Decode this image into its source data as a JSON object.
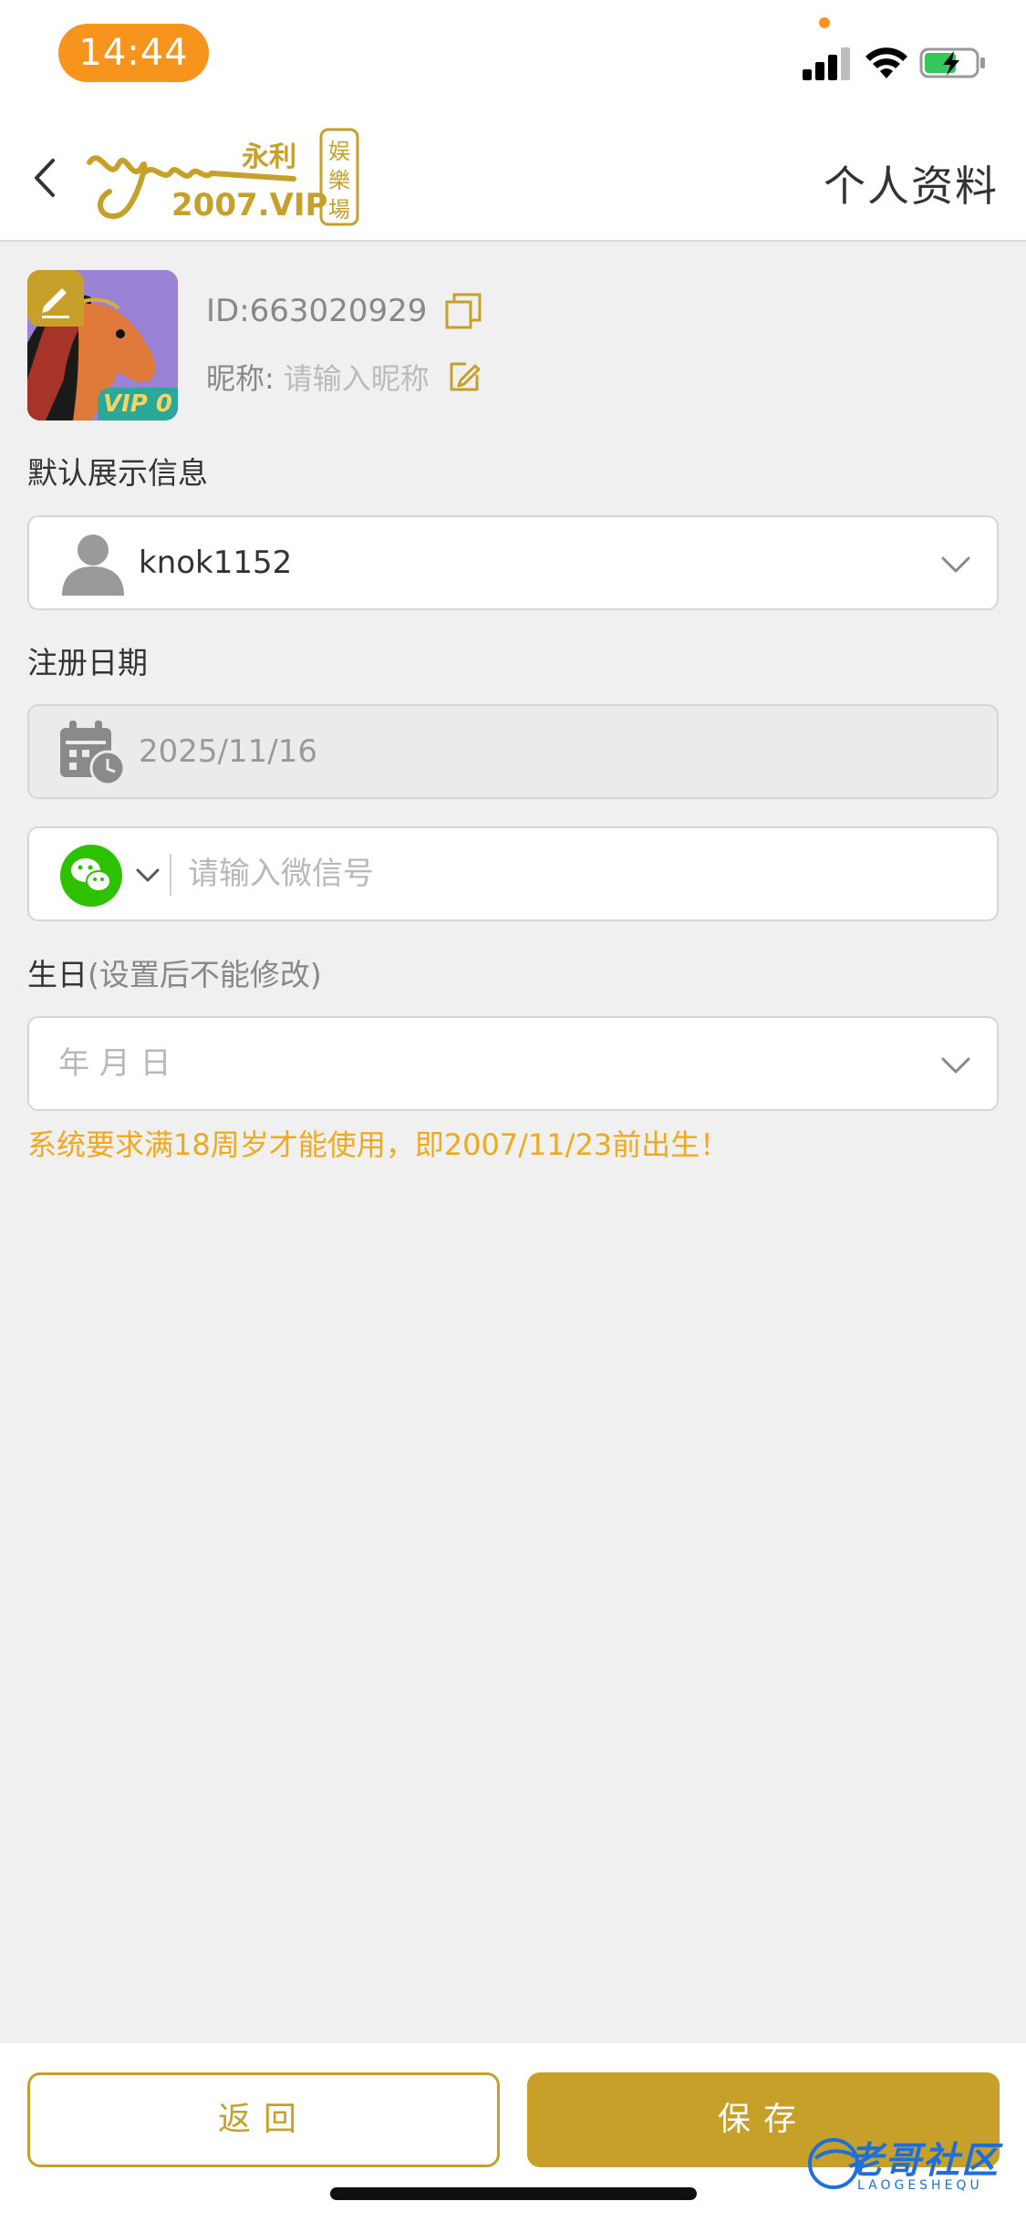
{
  "status_bar": {
    "time": "14:44"
  },
  "header": {
    "logo_brand_cn": "永利",
    "logo_domain": "2007.VIP",
    "logo_seal": "娱樂場",
    "title": "个人资料"
  },
  "profile": {
    "vip_badge": "VIP 0",
    "id_text": "ID:663020929",
    "nickname_label": "昵称:",
    "nickname_placeholder": "请输入昵称"
  },
  "default_info": {
    "label": "默认展示信息",
    "value": "knok1152"
  },
  "register_date": {
    "label": "注册日期",
    "value": "2025/11/16"
  },
  "wechat": {
    "placeholder": "请输入微信号"
  },
  "birthday": {
    "label": "生日",
    "hint": "(设置后不能修改)",
    "placeholder": "年 月 日",
    "warning": "系统要求满18周岁才能使用，即2007/11/23前出生！"
  },
  "actions": {
    "back_label": "返回",
    "save_label": "保存"
  },
  "watermark": {
    "text": "老哥社区",
    "sub": "LAOGESHEQU"
  },
  "colors": {
    "accent_gold": "#c7a02a",
    "status_orange": "#f7941d",
    "warning_yellow": "#f2a81d",
    "wechat_green": "#2dc100"
  }
}
